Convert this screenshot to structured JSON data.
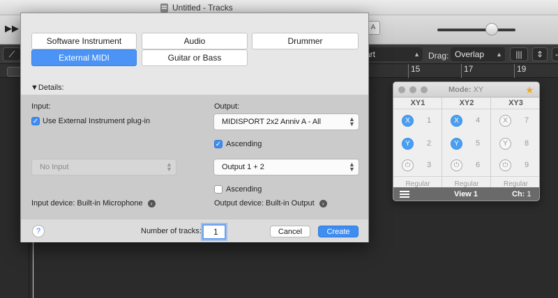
{
  "window": {
    "title": "Untitled - Tracks"
  },
  "toolbar": {
    "snap_value": "art",
    "drag_label": "Drag:",
    "drag_value": "Overlap"
  },
  "ruler": {
    "marks": [
      "15",
      "17",
      "19"
    ]
  },
  "dialog": {
    "track_types": [
      "Software Instrument",
      "Audio",
      "Drummer",
      "External MIDI",
      "Guitar or Bass"
    ],
    "selected_type": "External MIDI",
    "details_label": "Details:",
    "input_label": "Input:",
    "use_external_plugin_label": "Use External Instrument plug-in",
    "use_external_plugin_checked": true,
    "input_value": "No Input",
    "input_device_label": "Input device: Built-in Microphone",
    "output_label": "Output:",
    "midi_output_value": "MIDISPORT 2x2 Anniv A - All",
    "ascending_1_label": "Ascending",
    "ascending_1_checked": true,
    "audio_output_value": "Output 1 + 2",
    "ascending_2_label": "Ascending",
    "ascending_2_checked": false,
    "output_device_label": "Output device: Built-in Output",
    "help_label": "?",
    "ntracks_label": "Number of tracks:",
    "ntracks_value": "1",
    "cancel_label": "Cancel",
    "create_label": "Create"
  },
  "xy_panel": {
    "mode_label": "Mode:",
    "mode_value": "XY",
    "columns": [
      {
        "title": "XY1",
        "x_num": "1",
        "y_num": "2",
        "power_num": "3",
        "x_on": true,
        "y_on": true,
        "mode": "Regular"
      },
      {
        "title": "XY2",
        "x_num": "4",
        "y_num": "5",
        "power_num": "6",
        "x_on": true,
        "y_on": true,
        "mode": "Regular"
      },
      {
        "title": "XY3",
        "x_num": "7",
        "y_num": "8",
        "power_num": "9",
        "x_on": false,
        "y_on": false,
        "mode": "Regular"
      }
    ],
    "x_glyph": "X",
    "y_glyph": "Y",
    "view_label": "View 1",
    "channel_label": "Ch:",
    "channel_value": "1"
  },
  "colors": {
    "accent": "#3f8df0",
    "selected_segment": "#4b93f4",
    "star": "#f5a623"
  }
}
